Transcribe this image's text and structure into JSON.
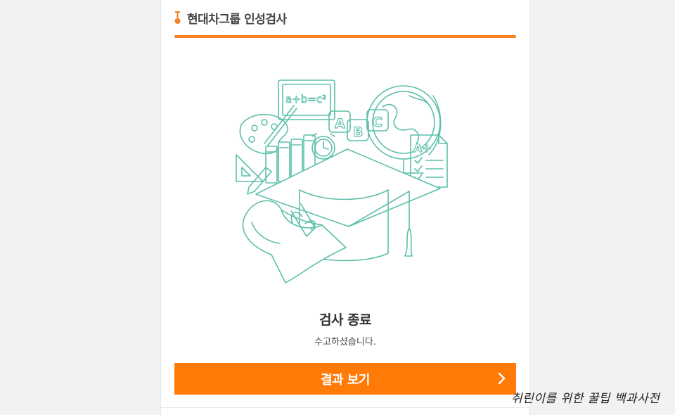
{
  "header": {
    "title": "현대차그룹 인성검사"
  },
  "illustration": {
    "equation": "a+b=c²",
    "letters": [
      "A",
      "B",
      "C"
    ],
    "grade": "A+"
  },
  "status": {
    "title": "검사 종료",
    "subtitle": "수고하셨습니다."
  },
  "action": {
    "label": "결과 보기"
  },
  "watermark": "취린이를 위한 꿀팁 백과사전",
  "colors": {
    "accent": "#ff7a07",
    "rule": "#f68121",
    "line_art": "#5cbfaa"
  },
  "icons": {
    "header": "pin-icon",
    "button": "chevron-right-icon"
  }
}
